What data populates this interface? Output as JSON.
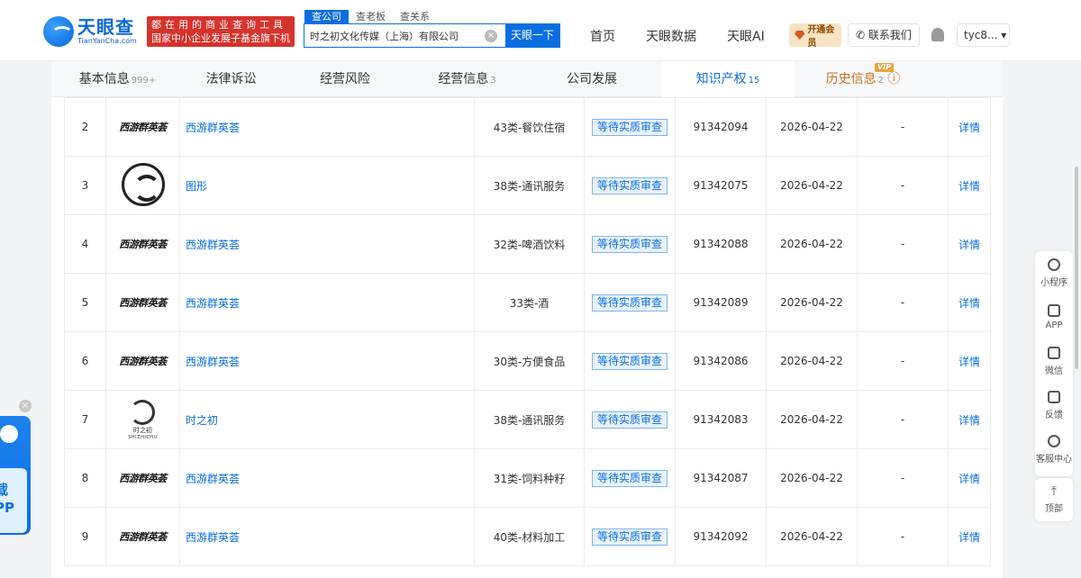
{
  "brand": {
    "name": "天眼查",
    "domain": "TianYanCha.com",
    "slogan_line1": "都在用的商业查询工具",
    "slogan_line2": "国家中小企业发展子基金旗下机构"
  },
  "search": {
    "tabs": [
      "查公司",
      "查老板",
      "查关系"
    ],
    "value": "时之初文化传媒（上海）有限公司",
    "button": "天眼一下"
  },
  "topnav": {
    "items": [
      "首页",
      "天眼数据",
      "天眼AI"
    ],
    "vip": "开通会员",
    "contact": "联系我们",
    "user": "tyc8..."
  },
  "tabs": [
    {
      "label": "基本信息",
      "count": "999+"
    },
    {
      "label": "法律诉讼",
      "count": ""
    },
    {
      "label": "经营风险",
      "count": ""
    },
    {
      "label": "经营信息",
      "count": "3"
    },
    {
      "label": "公司发展",
      "count": ""
    },
    {
      "label": "知识产权",
      "count": "15"
    },
    {
      "label": "历史信息",
      "count": "2",
      "tag": "VIP"
    }
  ],
  "table": {
    "rows": [
      {
        "no": "2",
        "logo": "西游群英荟",
        "name": "西游群英荟",
        "class": "43类-餐饮住宿",
        "status": "等待实质审查",
        "reg": "91342094",
        "date": "2026-04-22",
        "extra": "-",
        "action": "详情"
      },
      {
        "no": "3",
        "logo": "",
        "name": "图形",
        "class": "38类-通讯服务",
        "status": "等待实质审查",
        "reg": "91342075",
        "date": "2026-04-22",
        "extra": "-",
        "action": "详情"
      },
      {
        "no": "4",
        "logo": "西游群英荟",
        "name": "西游群英荟",
        "class": "32类-啤酒饮料",
        "status": "等待实质审查",
        "reg": "91342088",
        "date": "2026-04-22",
        "extra": "-",
        "action": "详情"
      },
      {
        "no": "5",
        "logo": "西游群英荟",
        "name": "西游群英荟",
        "class": "33类-酒",
        "status": "等待实质审查",
        "reg": "91342089",
        "date": "2026-04-22",
        "extra": "-",
        "action": "详情"
      },
      {
        "no": "6",
        "logo": "西游群英荟",
        "name": "西游群英荟",
        "class": "30类-方便食品",
        "status": "等待实质审查",
        "reg": "91342086",
        "date": "2026-04-22",
        "extra": "-",
        "action": "详情"
      },
      {
        "no": "7",
        "logo": "时之初",
        "name": "时之初",
        "class": "38类-通讯服务",
        "status": "等待实质审查",
        "reg": "91342083",
        "date": "2026-04-22",
        "extra": "-",
        "action": "详情"
      },
      {
        "no": "8",
        "logo": "西游群英荟",
        "name": "西游群英荟",
        "class": "31类-饲料种籽",
        "status": "等待实质审查",
        "reg": "91342087",
        "date": "2026-04-22",
        "extra": "-",
        "action": "详情"
      },
      {
        "no": "9",
        "logo": "西游群英荟",
        "name": "西游群英荟",
        "class": "40类-材料加工",
        "status": "等待实质审查",
        "reg": "91342092",
        "date": "2026-04-22",
        "extra": "-",
        "action": "详情"
      }
    ],
    "logo_sub": "SHIZHICHU"
  },
  "sidebar": {
    "items": [
      "小程序",
      "APP",
      "微信",
      "反馈",
      "客服中心"
    ],
    "top": "顶部"
  },
  "float_app": {
    "text1": "载",
    "text2": "PP"
  }
}
